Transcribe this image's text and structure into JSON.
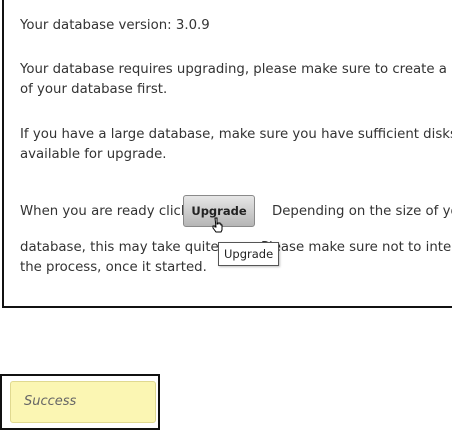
{
  "upgrade_panel": {
    "version_line": "Your database version: 3.0.9",
    "requires_line1": "Your database requires upgrading, please make sure to create a backup",
    "requires_line2": "of your database first.",
    "large_line1": "If you have a large database, make sure you have sufficient diskspace",
    "large_line2": "available for upgrade.",
    "ready_prefix": "When you are ready click",
    "upgrade_button_label": "Upgrade",
    "ready_suffix": "Depending on the size of your",
    "database_line_left": "database, this may take quite",
    "database_line_right": "Please make sure not to interrupt",
    "process_line": "the process, once it started.",
    "tooltip_text": "Upgrade"
  },
  "status": {
    "success_label": "Success"
  },
  "colors": {
    "success_background": "#fbf6b3",
    "button_gradient_top": "#e6e6e6",
    "button_gradient_bottom": "#b6b6b6"
  }
}
